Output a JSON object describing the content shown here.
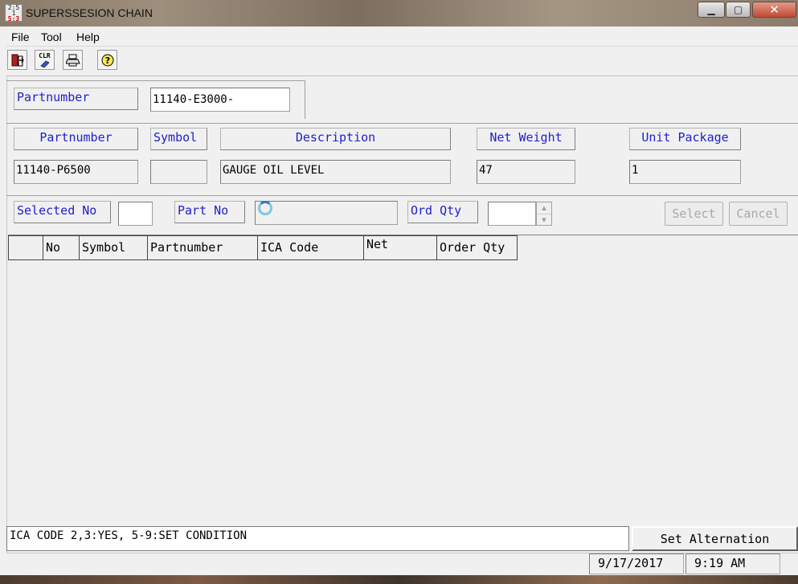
{
  "window": {
    "title": "SUPERSSESION CHAIN",
    "icon_lines": [
      "2:5",
      "1",
      "5:3"
    ],
    "controls": {
      "minimize": "▁",
      "maximize": "▢",
      "close": "✕"
    }
  },
  "menu": {
    "file": "File",
    "tool": "Tool",
    "help": "Help"
  },
  "toolbar": {
    "exit_icon": "exit-door-icon",
    "clear_label": "CLR",
    "print_icon": "printer-icon",
    "help_icon": "help-question-icon"
  },
  "search": {
    "label": "Partnumber",
    "value": "11140-E3000-"
  },
  "detail": {
    "partnumber_label": "Partnumber",
    "symbol_label": "Symbol",
    "description_label": "Description",
    "net_weight_label": "Net Weight",
    "unit_package_label": "Unit Package",
    "partnumber_value": "11140-P6500",
    "symbol_value": "",
    "description_value": "GAUGE OIL LEVEL",
    "net_weight_value": "47",
    "unit_package_value": "1"
  },
  "selection": {
    "selected_no_label": "Selected No",
    "selected_no_value": "",
    "part_no_label": "Part No",
    "part_no_value": "",
    "ord_qty_label": "Ord Qty",
    "ord_qty_value": "",
    "select_button": "Select",
    "cancel_button": "Cancel"
  },
  "grid": {
    "columns": [
      "",
      "No",
      "Symbol",
      "Partnumber",
      "ICA Code",
      "Net",
      "Order Qty"
    ],
    "rows": []
  },
  "footer": {
    "message": "ICA CODE 2,3:YES, 5-9:SET CONDITION",
    "set_alternation_button": "Set Alternation",
    "date": "9/17/2017",
    "time": "9:19 AM"
  },
  "colors": {
    "label_text": "#2020d0",
    "window_bg": "#f0f0f0",
    "close_button": "#c34a34"
  }
}
